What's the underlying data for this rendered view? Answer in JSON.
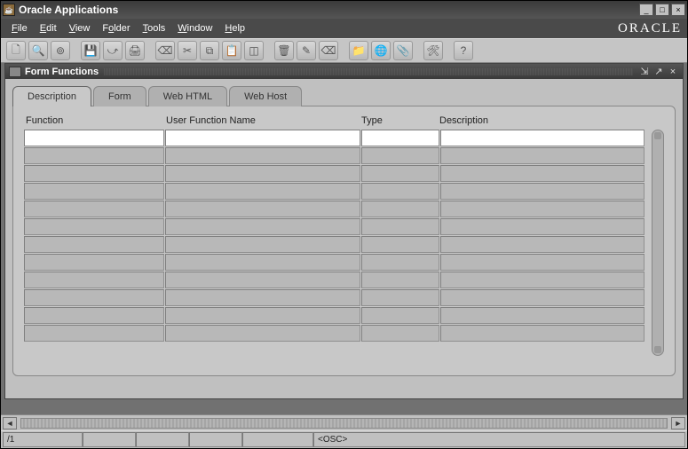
{
  "window": {
    "title": "Oracle Applications",
    "logo": "ORACLE"
  },
  "menu": [
    "File",
    "Edit",
    "View",
    "Folder",
    "Tools",
    "Window",
    "Help"
  ],
  "toolbar_icons": [
    "new",
    "find",
    "nav",
    "",
    "save",
    "next",
    "print",
    "",
    "close",
    "cut",
    "copy",
    "paste",
    "clear",
    "",
    "tool1",
    "edit",
    "eraser",
    "",
    "folder",
    "globe",
    "attach",
    "",
    "tools",
    "",
    "help"
  ],
  "form": {
    "title": "Form Functions",
    "tabs": [
      {
        "label": "Description",
        "active": true
      },
      {
        "label": "Form",
        "active": false
      },
      {
        "label": "Web HTML",
        "active": false
      },
      {
        "label": "Web Host",
        "active": false
      }
    ],
    "columns": [
      {
        "key": "function",
        "label": "Function"
      },
      {
        "key": "user_function_name",
        "label": "User Function Name"
      },
      {
        "key": "type",
        "label": "Type"
      },
      {
        "key": "description",
        "label": "Description"
      }
    ],
    "rows": [
      {
        "function": "",
        "user_function_name": "",
        "type": "",
        "description": "",
        "active": true
      },
      {
        "function": "",
        "user_function_name": "",
        "type": "",
        "description": ""
      },
      {
        "function": "",
        "user_function_name": "",
        "type": "",
        "description": ""
      },
      {
        "function": "",
        "user_function_name": "",
        "type": "",
        "description": ""
      },
      {
        "function": "",
        "user_function_name": "",
        "type": "",
        "description": ""
      },
      {
        "function": "",
        "user_function_name": "",
        "type": "",
        "description": ""
      },
      {
        "function": "",
        "user_function_name": "",
        "type": "",
        "description": ""
      },
      {
        "function": "",
        "user_function_name": "",
        "type": "",
        "description": ""
      },
      {
        "function": "",
        "user_function_name": "",
        "type": "",
        "description": ""
      },
      {
        "function": "",
        "user_function_name": "",
        "type": "",
        "description": ""
      },
      {
        "function": "",
        "user_function_name": "",
        "type": "",
        "description": ""
      },
      {
        "function": "",
        "user_function_name": "",
        "type": "",
        "description": ""
      }
    ]
  },
  "status": {
    "field1": "/1",
    "field5": "<OSC>"
  }
}
